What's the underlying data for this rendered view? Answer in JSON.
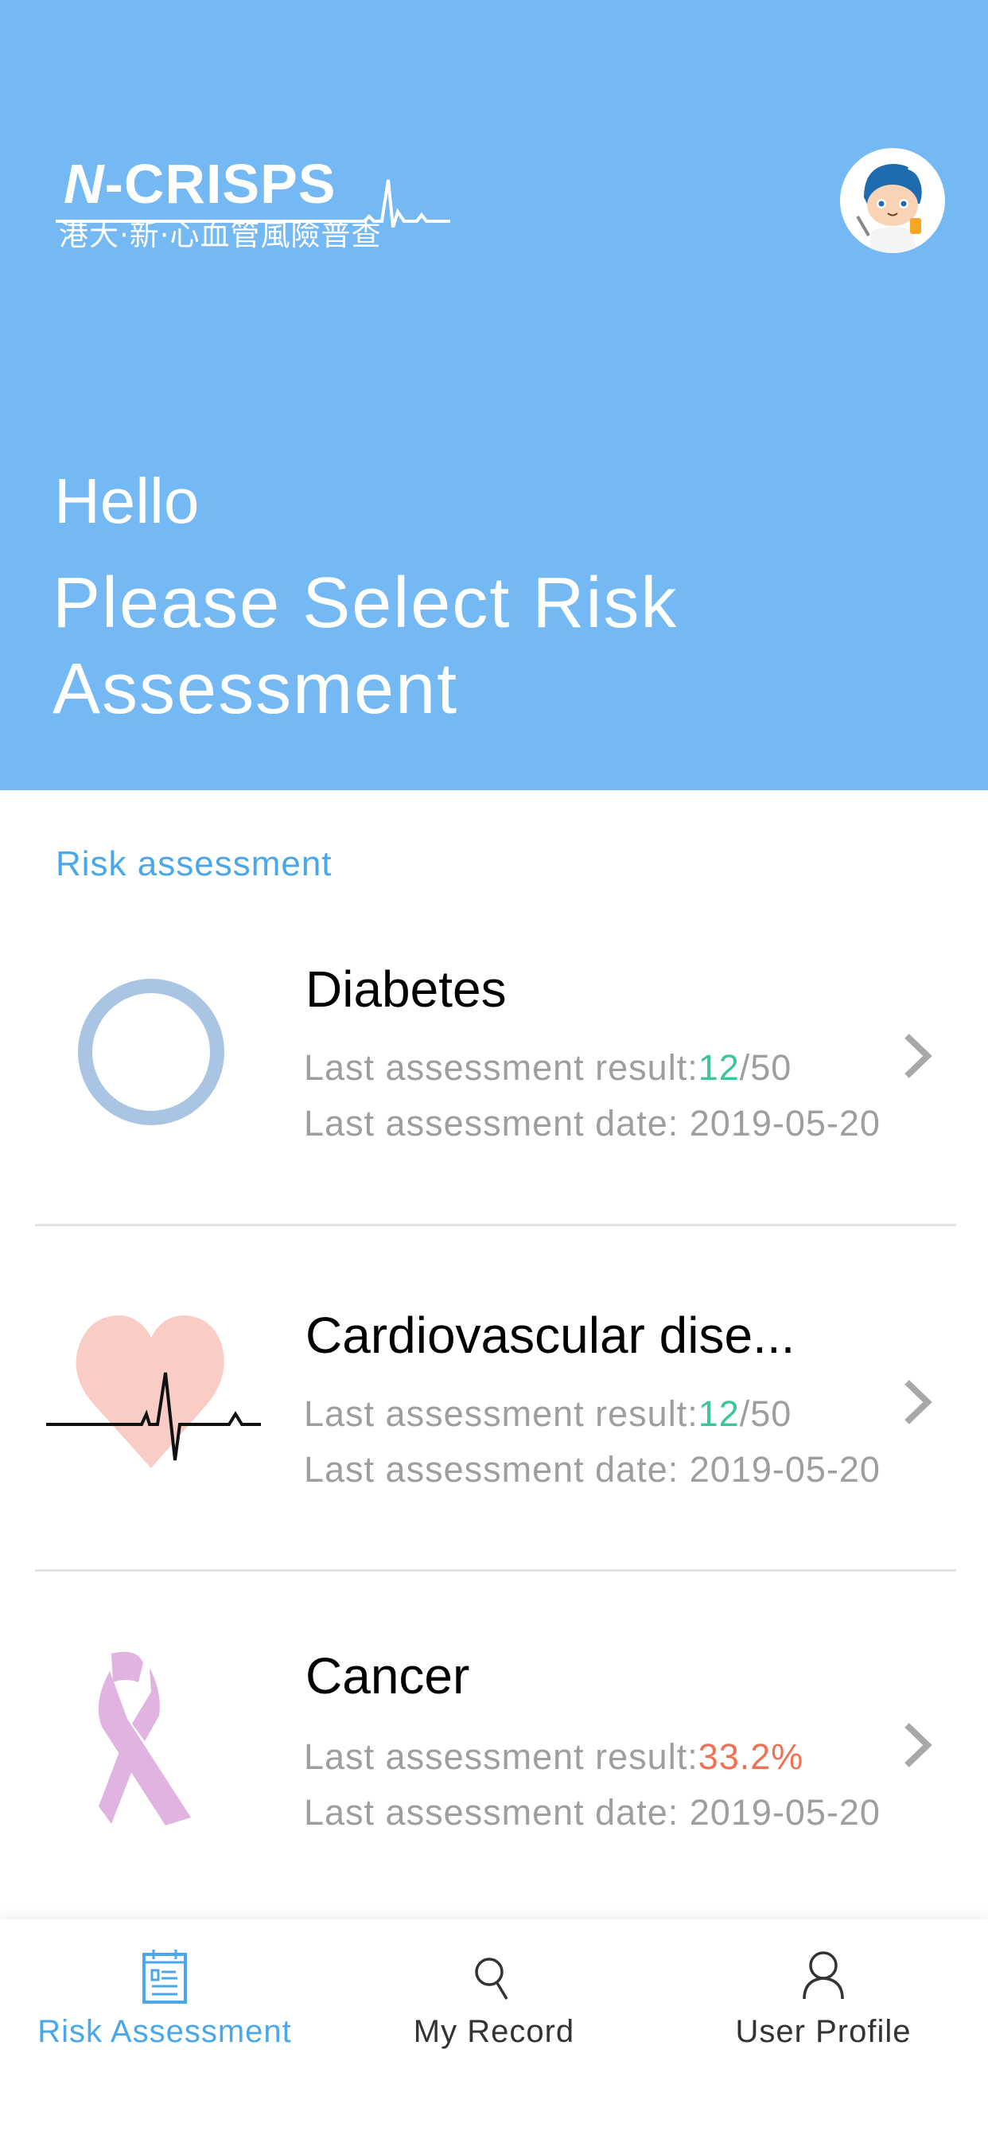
{
  "header": {
    "logo_title_prefix": "N",
    "logo_title_rest": "-CRISPS",
    "logo_subtitle": "港大·新·心血管風險普查",
    "greeting": "Hello",
    "prompt": "Please Select Risk Assessment",
    "background_color": "#74b9f3",
    "avatar": "doctor-mascot-avatar"
  },
  "section": {
    "title": "Risk assessment"
  },
  "assessments": [
    {
      "name": "Diabetes",
      "icon": "ring-icon",
      "result_label": "Last assessment result:",
      "result_value": "12",
      "result_suffix": "/50",
      "result_color": "#3dc596",
      "date_label": "Last assessment date:",
      "date_value": "2019-05-20"
    },
    {
      "name": "Cardiovascular dise...",
      "icon": "heart-pulse-icon",
      "result_label": "Last assessment result:",
      "result_value": "12",
      "result_suffix": "/50",
      "result_color": "#3dc596",
      "date_label": "Last assessment date:",
      "date_value": "2019-05-20"
    },
    {
      "name": "Cancer",
      "icon": "awareness-ribbon-icon",
      "result_label": "Last assessment result:",
      "result_value": "33.2%",
      "result_suffix": "",
      "result_color": "#ee7256",
      "date_label": "Last assessment date:",
      "date_value": "2019-05-20"
    }
  ],
  "tabbar": {
    "tabs": [
      {
        "label": "Risk Assessment",
        "icon": "clipboard-icon",
        "active": true
      },
      {
        "label": "My Record",
        "icon": "search-icon",
        "active": false
      },
      {
        "label": "User Profile",
        "icon": "user-icon",
        "active": false
      }
    ],
    "active_color": "#4aa7ea"
  }
}
